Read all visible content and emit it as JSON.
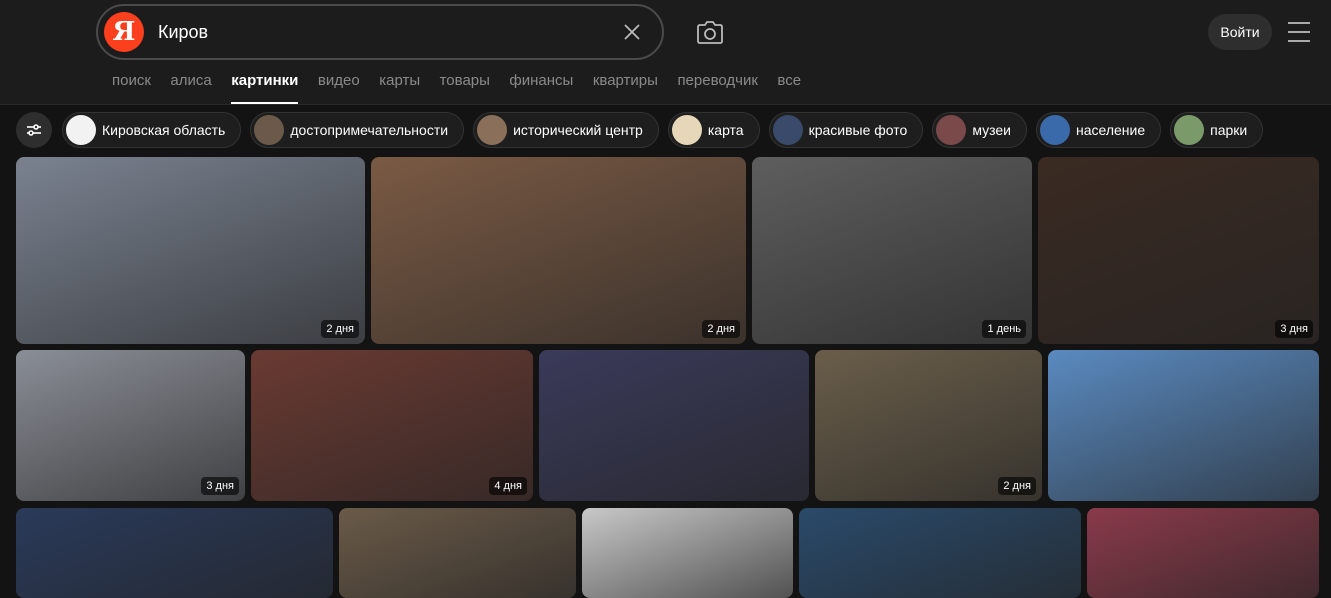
{
  "search": {
    "logo_letter": "Я",
    "query": "Киров"
  },
  "header": {
    "login_label": "Войти"
  },
  "tabs": [
    {
      "label": "поиск"
    },
    {
      "label": "алиса"
    },
    {
      "label": "картинки",
      "active": true
    },
    {
      "label": "видео"
    },
    {
      "label": "карты"
    },
    {
      "label": "товары"
    },
    {
      "label": "финансы"
    },
    {
      "label": "квартиры"
    },
    {
      "label": "переводчик"
    },
    {
      "label": "все"
    }
  ],
  "chips": [
    {
      "label": "Кировская область",
      "color": "#f2f2f2"
    },
    {
      "label": "достопримечательности",
      "color": "#6b5a4a"
    },
    {
      "label": "исторический центр",
      "color": "#8a6f5a"
    },
    {
      "label": "карта",
      "color": "#e6d7b8"
    },
    {
      "label": "красивые фото",
      "color": "#3a4a6a"
    },
    {
      "label": "музеи",
      "color": "#7a4a4a"
    },
    {
      "label": "население",
      "color": "#3a6aaa"
    },
    {
      "label": "парки",
      "color": "#7a9a6a"
    }
  ],
  "images": [
    {
      "badge": "2 дня",
      "color": "#7a8290"
    },
    {
      "badge": "2 дня",
      "color": "#7a5a44"
    },
    {
      "badge": "1 день",
      "color": "#5e5e5e"
    },
    {
      "badge": "3 дня",
      "color": "#3a2a22"
    },
    {
      "badge": "3 дня",
      "color": "#8a8e96"
    },
    {
      "badge": "4 дня",
      "color": "#6a3a32"
    },
    {
      "badge": "",
      "color": "#3a3a5a"
    },
    {
      "badge": "2 дня",
      "color": "#6a5e4a"
    },
    {
      "badge": "",
      "color": "#5a8ac0"
    },
    {
      "badge": "",
      "color": "#2a3a5a"
    },
    {
      "badge": "",
      "color": "#6a5a48"
    },
    {
      "badge": "",
      "color": "#c8c8c8"
    },
    {
      "badge": "",
      "color": "#2a4a6a"
    },
    {
      "badge": "",
      "color": "#8a3a4a"
    }
  ]
}
